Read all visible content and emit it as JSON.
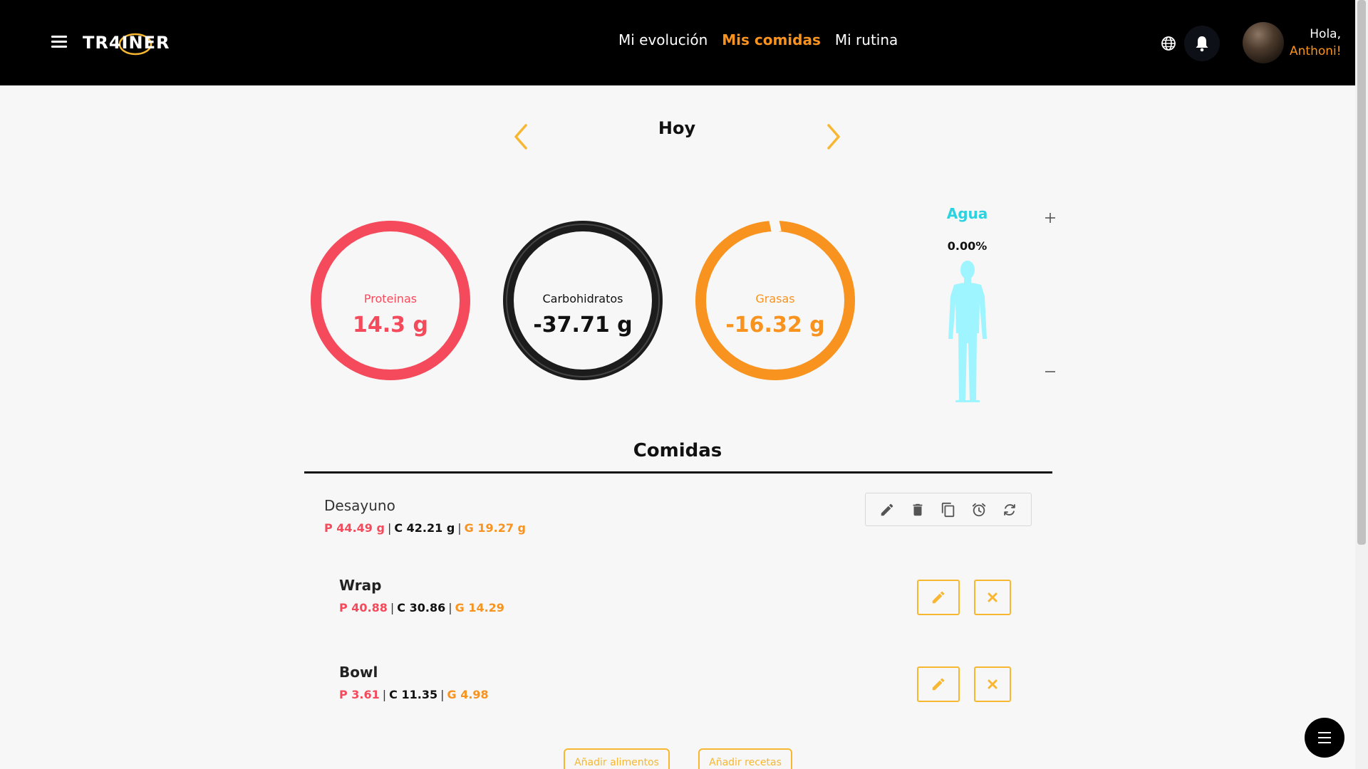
{
  "header": {
    "logo_text": "TR4INER",
    "nav": [
      {
        "label": "Mi evolución",
        "active": false
      },
      {
        "label": "Mis comidas",
        "active": true
      },
      {
        "label": "Mi rutina",
        "active": false
      }
    ],
    "greeting": "Hola,",
    "user_name": "Anthoni!"
  },
  "date_nav": {
    "title": "Hoy",
    "prev_icon": "chevron-left-icon",
    "next_icon": "chevron-right-icon"
  },
  "macros": {
    "protein": {
      "label": "Proteinas",
      "value": "14.3 g",
      "color": "#f44a5b"
    },
    "carbs": {
      "label": "Carbohidratos",
      "value": "-37.71 g",
      "color": "#1c1c1c"
    },
    "fat": {
      "label": "Grasas",
      "value": "-16.32 g",
      "color": "#f7931e"
    }
  },
  "water": {
    "title": "Agua",
    "percent": "0.00%",
    "fill_fraction": 0,
    "color": "#2ad3df"
  },
  "comidas": {
    "title": "Comidas",
    "meals": [
      {
        "name": "Desayuno",
        "p": "P 44.49 g",
        "c": "C 42.21 g",
        "g": "G 19.27 g",
        "sep": "|",
        "actions": [
          "edit-icon",
          "trash-icon",
          "copy-icon",
          "alarm-icon",
          "refresh-icon"
        ],
        "foods": [
          {
            "name": "Wrap",
            "p": "P 40.88",
            "c": "C 30.86",
            "g": "G 14.29"
          },
          {
            "name": "Bowl",
            "p": "P 3.61",
            "c": "C 11.35",
            "g": "G 4.98"
          }
        ]
      }
    ],
    "add_food_label": "Añadir alimentos",
    "add_recipe_label": "Añadir recetas"
  },
  "colors": {
    "accent": "#f7931e",
    "button_border": "#f7b731",
    "header_bg": "#000000"
  }
}
